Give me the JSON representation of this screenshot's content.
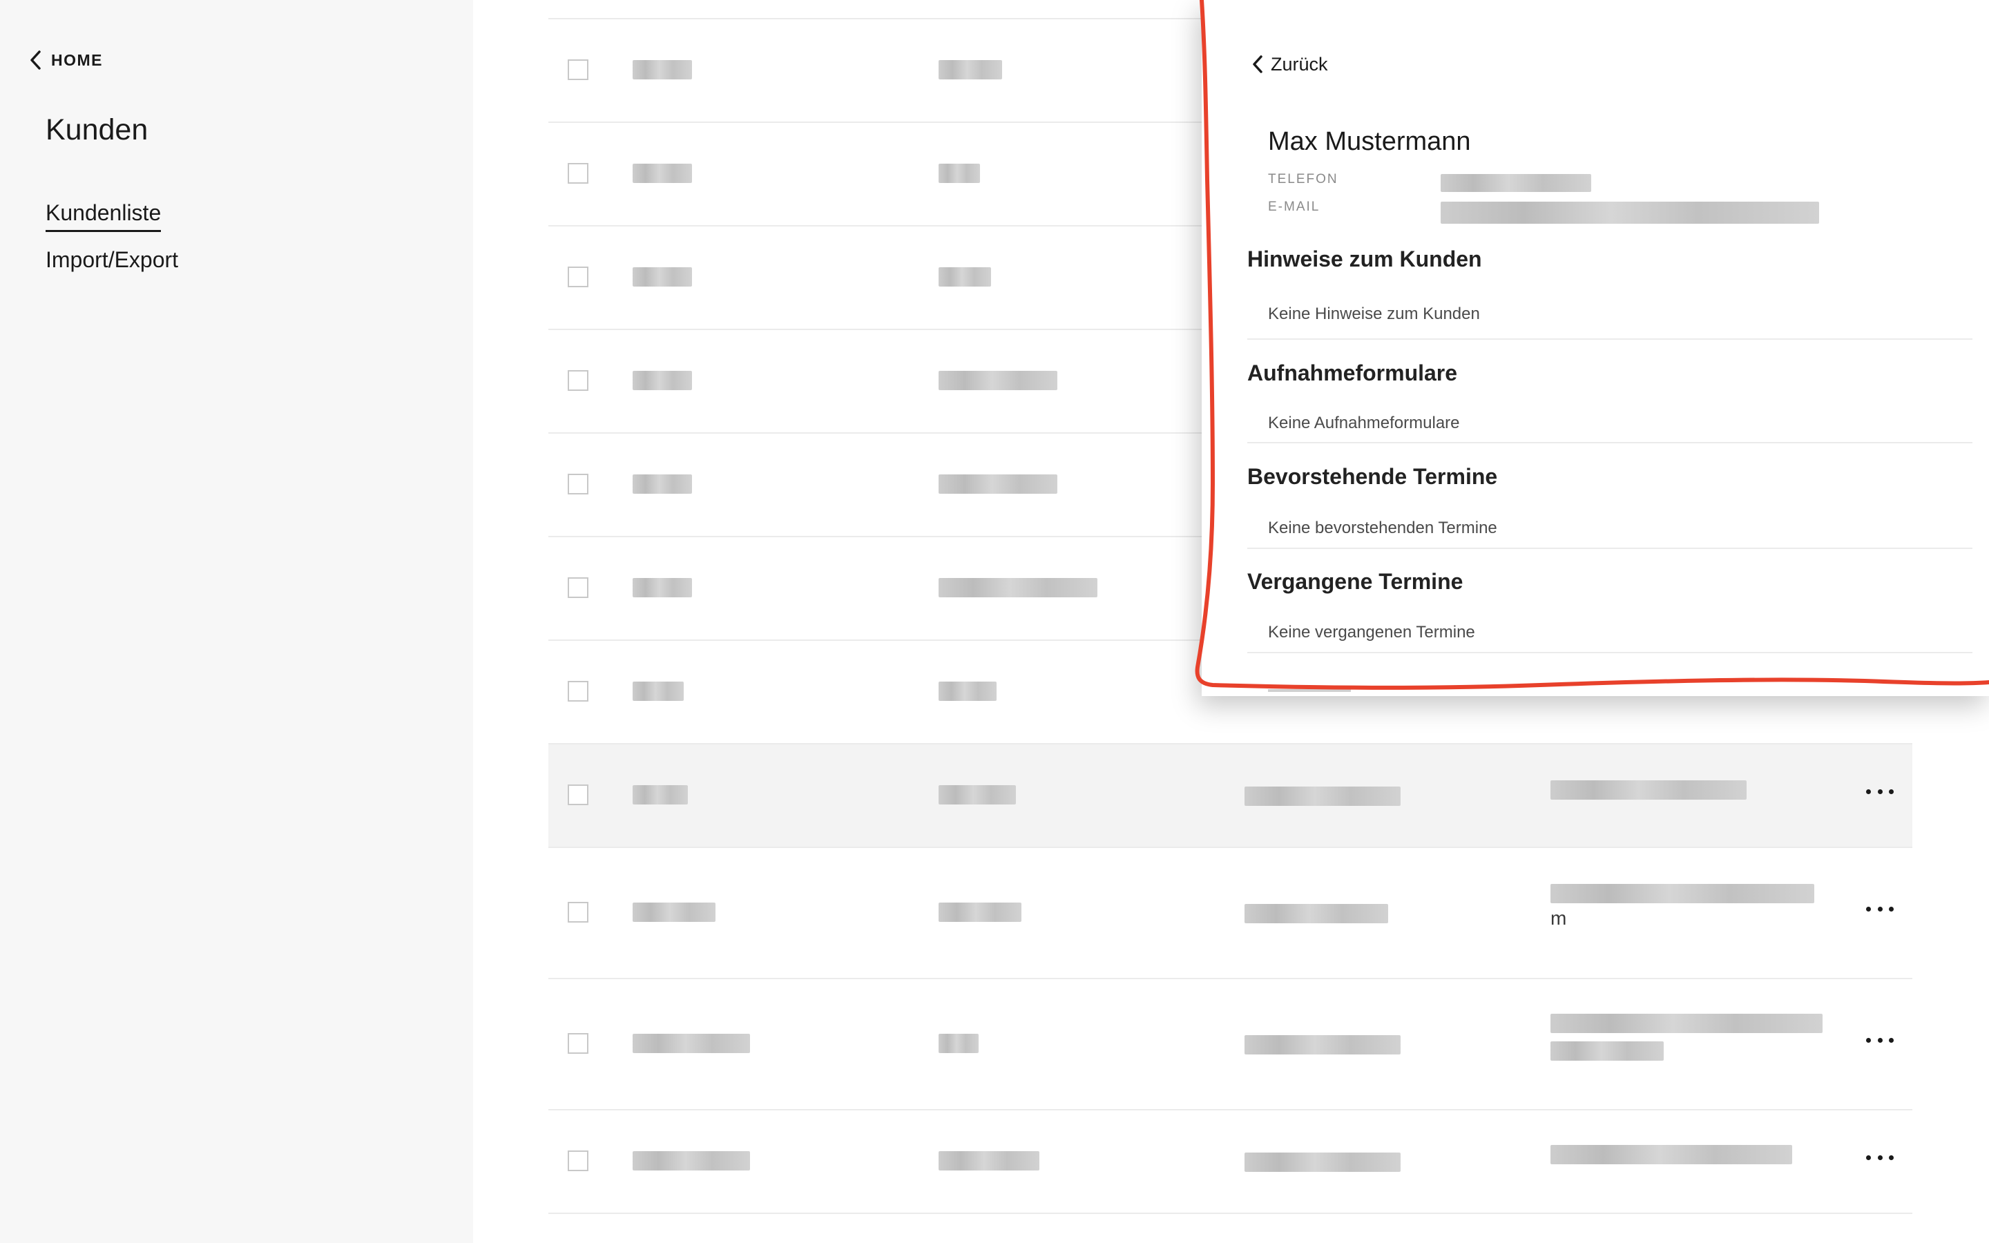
{
  "sidebar": {
    "home_label": "HOME",
    "title": "Kunden",
    "nav": [
      {
        "label": "Kundenliste",
        "active": true
      },
      {
        "label": "Import/Export",
        "active": false
      }
    ]
  },
  "table": {
    "stray_text": "m"
  },
  "panel": {
    "back_label": "Zurück",
    "customer_name": "Max Mustermann",
    "phone_label": "TELEFON",
    "email_label": "E-MAIL",
    "sections": [
      {
        "title": "Hinweise zum Kunden",
        "empty_text": "Keine Hinweise zum Kunden"
      },
      {
        "title": "Aufnahmeformulare",
        "empty_text": "Keine Aufnahmeformulare"
      },
      {
        "title": "Bevorstehende Termine",
        "empty_text": "Keine bevorstehenden Termine"
      },
      {
        "title": "Vergangene Termine",
        "empty_text": "Keine vergangenen Termine"
      }
    ]
  },
  "colors": {
    "accent_annotation": "#e8412b",
    "sidebar_bg": "#f7f7f7",
    "highlight_row": "#f3f3f3"
  },
  "icons": {
    "home": "chevron-left-icon",
    "back": "chevron-left-icon",
    "row_menu": "more-horizontal-icon"
  }
}
